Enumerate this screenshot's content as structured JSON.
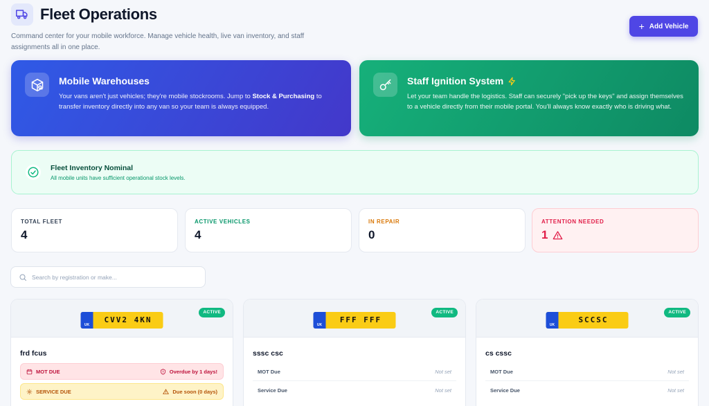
{
  "header": {
    "title": "Fleet Operations",
    "subtitle": "Command center for your mobile workforce. Manage vehicle health, live van inventory, and staff assignments all in one place.",
    "add_vehicle_label": "Add Vehicle",
    "icon": "truck-icon"
  },
  "promos": {
    "warehouses": {
      "title": "Mobile Warehouses",
      "text_before": "Your vans aren't just vehicles; they're mobile stockrooms. Jump to ",
      "link": "Stock & Purchasing",
      "text_after": " to transfer inventory directly into any van so your team is always equipped.",
      "icon": "box-search-icon",
      "color": "#2f5ae6"
    },
    "ignition": {
      "title": "Staff Ignition System",
      "text": "Let your team handle the logistics. Staff can securely \"pick up the keys\" and assign themselves to a vehicle directly from their mobile portal. You'll always know exactly who is driving what.",
      "icon": "key-icon",
      "color": "#16b07a"
    }
  },
  "inventory_status": {
    "title": "Fleet Inventory Nominal",
    "message": "All mobile units have sufficient operational stock levels."
  },
  "stats": [
    {
      "label": "TOTAL FLEET",
      "value": "4",
      "color": "#334155"
    },
    {
      "label": "ACTIVE VEHICLES",
      "value": "4",
      "color": "#059669"
    },
    {
      "label": "IN REPAIR",
      "value": "0",
      "color": "#d97706"
    },
    {
      "label": "ATTENTION NEEDED",
      "value": "1",
      "color": "#e11d48"
    }
  ],
  "search": {
    "placeholder": "Search by registration or make..."
  },
  "vehicles": [
    {
      "plate_country": "UK",
      "registration": "CVV2 4KN",
      "status": "ACTIVE",
      "name": "frd fcus",
      "mot_label": "MOT DUE",
      "mot_value": "Overdue by 1 days!",
      "service_label": "SERVICE DUE",
      "service_value": "Due soon (0 days)"
    },
    {
      "plate_country": "UK",
      "registration": "FFF FFF",
      "status": "ACTIVE",
      "name": "sssc csc",
      "mot_label": "MOT Due",
      "mot_value": "Not set",
      "service_label": "Service Due",
      "service_value": "Not set"
    },
    {
      "plate_country": "UK",
      "registration": "SCCSC",
      "status": "ACTIVE",
      "name": "cs cssc",
      "mot_label": "MOT Due",
      "mot_value": "Not set",
      "service_label": "Service Due",
      "service_value": "Not set"
    }
  ]
}
